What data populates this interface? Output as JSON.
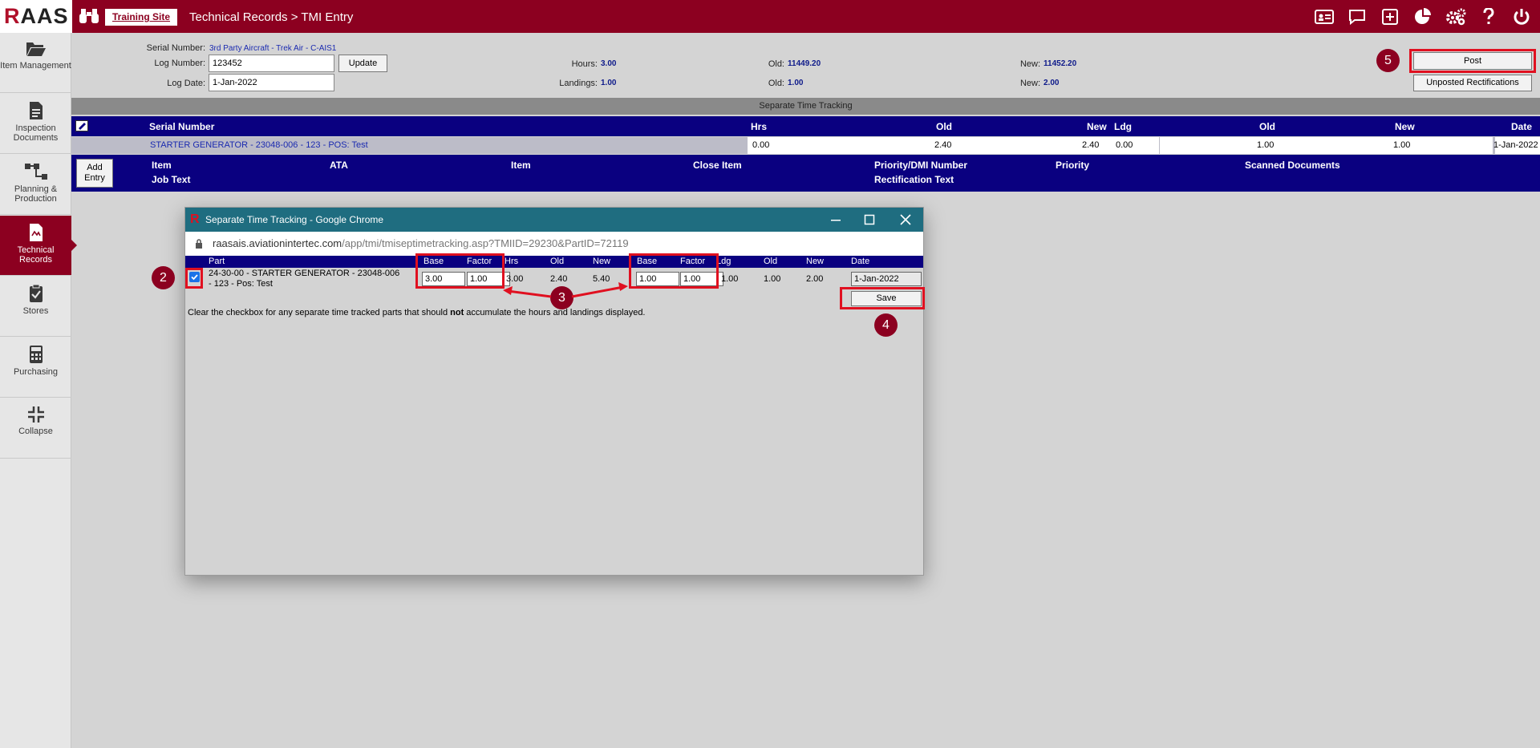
{
  "topbar": {
    "logo": "RAAS",
    "site_link": "Training Site",
    "breadcrumb": "Technical Records > TMI Entry",
    "icons": [
      "id-card-icon",
      "comment-icon",
      "plus-square-icon",
      "pie-chart-icon",
      "gears-icon",
      "help-icon",
      "power-icon"
    ]
  },
  "sidebar": {
    "items": [
      {
        "label": "Item Management",
        "icon": "folder-icon"
      },
      {
        "label": "Inspection Documents",
        "icon": "document-icon"
      },
      {
        "label": "Planning & Production",
        "icon": "flow-icon"
      },
      {
        "label": "Technical Records",
        "icon": "records-icon"
      },
      {
        "label": "Stores",
        "icon": "clipboard-check-icon"
      },
      {
        "label": "Purchasing",
        "icon": "calculator-icon"
      },
      {
        "label": "Collapse",
        "icon": "collapse-icon"
      }
    ],
    "active": "Technical Records"
  },
  "header": {
    "serial_label": "Serial Number:",
    "serial_value": "3rd Party Aircraft - Trek Air - C-AIS1",
    "log_number_label": "Log Number:",
    "log_number_value": "123452",
    "update_label": "Update",
    "log_date_label": "Log Date:",
    "log_date_value": "1-Jan-2022",
    "hours_label": "Hours:",
    "hours_value": "3.00",
    "landings_label": "Landings:",
    "landings_value": "1.00",
    "old1_label": "Old:",
    "old1_value": "11449.20",
    "old2_label": "Old:",
    "old2_value": "1.00",
    "new1_label": "New:",
    "new1_value": "11452.20",
    "new2_label": "New:",
    "new2_value": "2.00",
    "post_label": "Post",
    "unposted_label": "Unposted Rectifications"
  },
  "separate_time_tracking": {
    "title": "Separate Time Tracking",
    "columns": {
      "serial": "Serial Number",
      "hrs": "Hrs",
      "old": "Old",
      "new": "New",
      "ldg": "Ldg",
      "old2": "Old",
      "new2": "New",
      "date": "Date"
    },
    "row": {
      "serial": "STARTER GENERATOR - 23048-006 - 123 - POS: Test",
      "hrs": "0.00",
      "old": "2.40",
      "new": "2.40",
      "ldg": "0.00",
      "old2": "1.00",
      "new2": "1.00",
      "date": "1-Jan-2022"
    }
  },
  "entries": {
    "add_label_1": "Add",
    "add_label_2": "Entry",
    "columns": {
      "item": "Item",
      "ata": "ATA",
      "item2": "Item",
      "close_item": "Close Item",
      "priority_dmi": "Priority/DMI Number",
      "priority": "Priority",
      "scanned": "Scanned Documents",
      "job_text": "Job Text",
      "rect_text": "Rectification Text"
    }
  },
  "popup": {
    "title": "Separate Time Tracking - Google Chrome",
    "url_host": "raasais.aviationintertec.com",
    "url_path": "/app/tmi/tmiseptimetracking.asp?TMIID=29230&PartID=72119",
    "columns": {
      "part": "Part",
      "base": "Base",
      "factor": "Factor",
      "hrs": "Hrs",
      "old": "Old",
      "new": "New",
      "base2": "Base",
      "factor2": "Factor",
      "ldg": "Ldg",
      "old2": "Old",
      "new2": "New",
      "date": "Date"
    },
    "row": {
      "checked": true,
      "part_line1": "24-30-00 - STARTER GENERATOR - 23048-006",
      "part_line2": "- 123 - Pos: Test",
      "base": "3.00",
      "factor": "1.00",
      "hrs": "3.00",
      "old": "2.40",
      "new": "5.40",
      "base2": "1.00",
      "factor2": "1.00",
      "ldg": "1.00",
      "old2": "1.00",
      "new2": "2.00",
      "date": "1-Jan-2022"
    },
    "save_label": "Save",
    "note_before": "Clear the checkbox for any separate time tracked parts that should ",
    "note_bold": "not",
    "note_after": " accumulate the hours and landings displayed."
  },
  "callouts": {
    "c2": "2",
    "c3": "3",
    "c4": "4",
    "c5": "5"
  },
  "colors": {
    "brand": "#8c0020",
    "header_navy": "#0a0080",
    "popup_title": "#1f6d80",
    "callout_red": "#e01020"
  }
}
